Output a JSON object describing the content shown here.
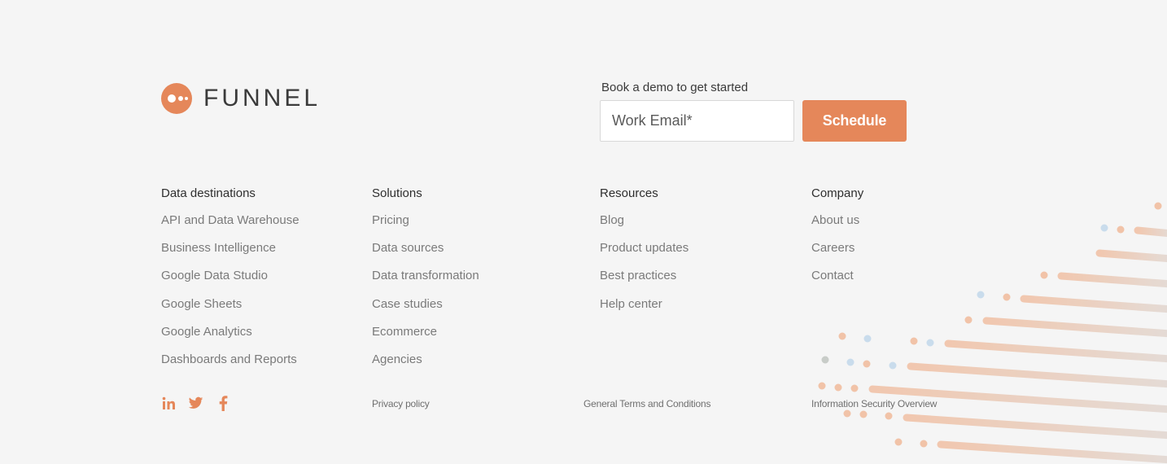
{
  "brand": {
    "name": "FUNNEL",
    "accent_color": "#e5875a"
  },
  "demo": {
    "title": "Book a demo to get started",
    "email_placeholder": "Work Email*",
    "schedule_label": "Schedule"
  },
  "columns": [
    {
      "heading": "Data destinations",
      "items": [
        "API and Data Warehouse",
        "Business Intelligence",
        "Google Data Studio",
        "Google Sheets",
        "Google Analytics",
        "Dashboards and Reports"
      ]
    },
    {
      "heading": "Solutions",
      "items": [
        "Pricing",
        "Data sources",
        "Data transformation",
        "Case studies",
        "Ecommerce",
        "Agencies"
      ]
    },
    {
      "heading": "Resources",
      "items": [
        "Blog",
        "Product updates",
        "Best practices",
        "Help center"
      ]
    },
    {
      "heading": "Company",
      "items": [
        "About us",
        "Careers",
        "Contact"
      ]
    }
  ],
  "social": [
    {
      "name": "linkedin-icon",
      "glyph": "in"
    },
    {
      "name": "twitter-icon",
      "glyph": "twitter"
    },
    {
      "name": "facebook-icon",
      "glyph": "f"
    }
  ],
  "legal": {
    "privacy": "Privacy policy",
    "terms": "General Terms and Conditions",
    "security": "Information Security Overview"
  }
}
